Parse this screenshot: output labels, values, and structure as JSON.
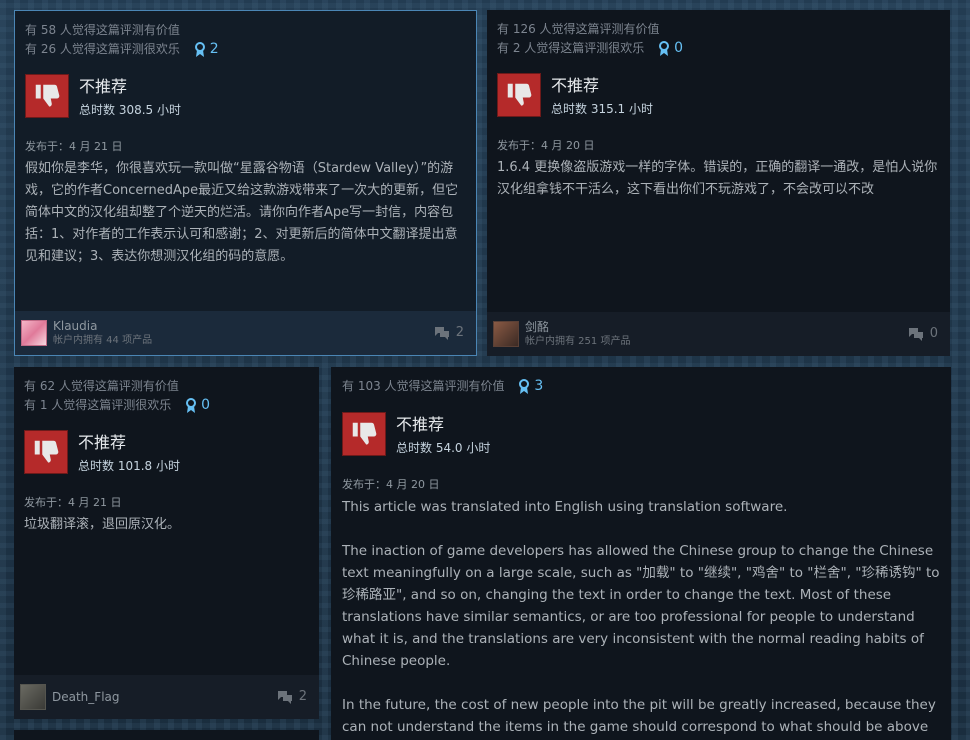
{
  "reviews": [
    {
      "helpful": "有 58 人觉得这篇评测有价值",
      "funny": "有 26 人觉得这篇评测很欢乐",
      "awards": "2",
      "verdict": "不推荐",
      "hours": "总时数 308.5 小时",
      "posted": "发布于：4 月 21 日",
      "text": "假如你是李华，你很喜欢玩一款叫做“星露谷物语（Stardew Valley）”的游戏，它的作者ConcernedApe最近又给这款游戏带来了一次大的更新，但它简体中文的汉化组却整了个逆天的烂活。请你向作者Ape写一封信，内容包括：1、对作者的工作表示认可和感谢；2、对更新后的简体中文翻译提出意见和建议；3、表达你想测汉化组的码的意愿。",
      "user": "Klaudia",
      "products": "帐户内拥有 44 项产品",
      "comments": "2"
    },
    {
      "helpful": "有 126 人觉得这篇评测有价值",
      "funny": "有 2 人觉得这篇评测很欢乐",
      "awards": "0",
      "verdict": "不推荐",
      "hours": "总时数 315.1 小时",
      "posted": "发布于：4 月 20 日",
      "text": "1.6.4 更换像盗版游戏一样的字体。错误的，正确的翻译一通改，是怕人说你汉化组拿钱不干活么，这下看出你们不玩游戏了，不会改可以不改",
      "user": "剑酩",
      "products": "帐户内拥有 251 项产品",
      "comments": "0"
    },
    {
      "helpful": "有 62 人觉得这篇评测有价值",
      "funny": "有 1 人觉得这篇评测很欢乐",
      "awards": "0",
      "verdict": "不推荐",
      "hours": "总时数 101.8 小时",
      "posted": "发布于：4 月 21 日",
      "text": "垃圾翻译滚，退回原汉化。",
      "user": "Death_Flag",
      "products": "",
      "comments": "2"
    },
    {
      "helpful": "有 103 人觉得这篇评测有价值",
      "awards": "3",
      "verdict": "不推荐",
      "hours": "总时数 54.0 小时",
      "posted": "发布于：4 月 20 日",
      "paragraphs": [
        "This article was translated into English using translation software.",
        "The inaction of game developers has allowed the Chinese group to change the Chinese text meaningfully on a large scale, such as \"加载\" to \"继续\", \"鸡舍\" to \"栏舍\", \"珍稀诱钩\" to 珍稀路亚\", and so on, changing the text in order to change the text. Most of these translations have similar semantics, or are too professional for people to understand what it is, and the translations are very inconsistent with the normal reading habits of Chinese people.",
        "In the future, the cost of new people into the pit will be greatly increased, because they can not understand the items in the game should correspond to what should be above the walkthrough."
      ]
    }
  ],
  "colors": {
    "accent": "#66c0f4",
    "thumb_bg": "#b52a2a",
    "card_bg": "#0f151d"
  },
  "icons": {
    "thumb": "thumbs-down-icon",
    "award": "award-ribbon-icon",
    "comment": "comment-bubble-icon"
  }
}
